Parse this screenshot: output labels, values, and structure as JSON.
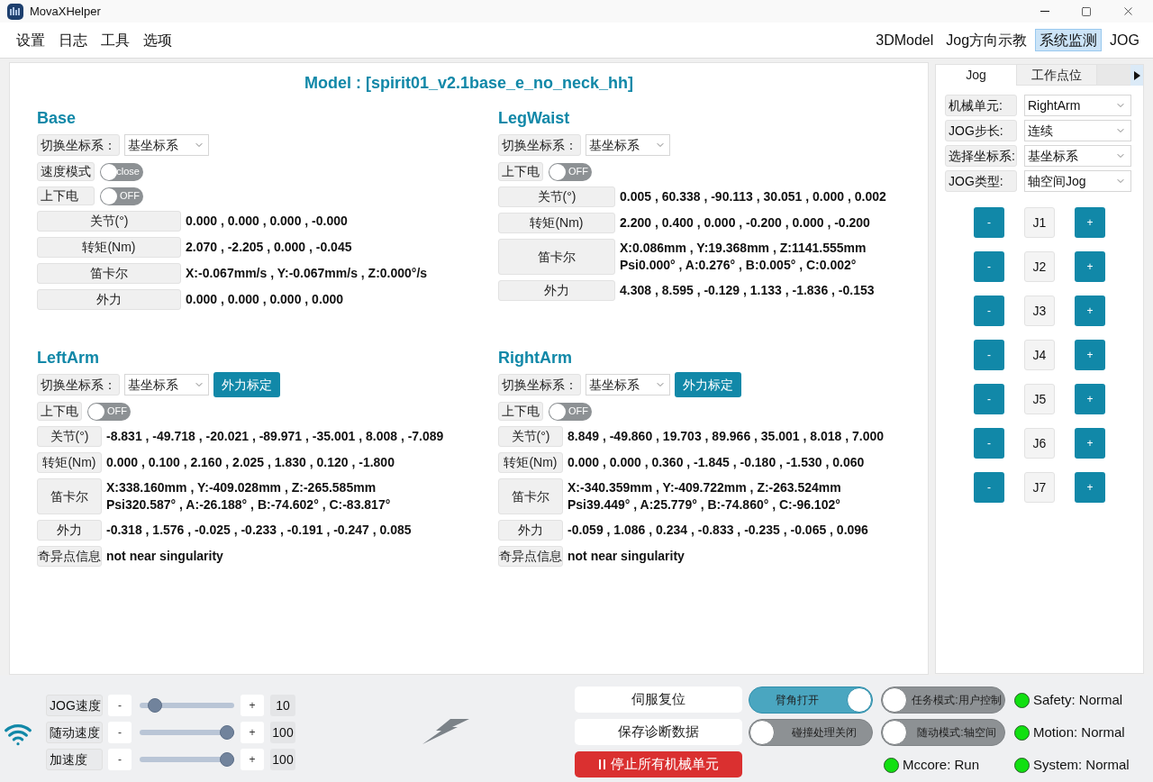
{
  "window": {
    "title": "MovaXHelper"
  },
  "menu": [
    "设置",
    "日志",
    "工具",
    "选项"
  ],
  "view_tabs": [
    {
      "label": "3DModel",
      "selected": false
    },
    {
      "label": "Jog方向示教",
      "selected": false
    },
    {
      "label": "系统监测",
      "selected": true
    },
    {
      "label": "JOG",
      "selected": false
    }
  ],
  "model_title": "Model : [spirit01_v2.1base_e_no_neck_hh]",
  "units": [
    {
      "name": "Base",
      "frame": {
        "label": "切换坐标系：",
        "value": "基坐标系"
      },
      "switches": [
        {
          "label": "速度模式",
          "text": "close",
          "on": false
        },
        {
          "label": "上下电",
          "text": "OFF",
          "on": false
        }
      ],
      "readings": [
        {
          "label": "关节(°)",
          "lines": [
            "0.000 , 0.000 , 0.000 , -0.000"
          ]
        },
        {
          "label": "转矩(Nm)",
          "lines": [
            "2.070 , -2.205 , 0.000 , -0.045"
          ]
        },
        {
          "label": "笛卡尔",
          "lines": [
            "X:-0.067mm/s , Y:-0.067mm/s , Z:0.000°/s"
          ]
        },
        {
          "label": "外力",
          "lines": [
            "0.000 , 0.000 , 0.000 , 0.000"
          ]
        }
      ]
    },
    {
      "name": "LegWaist",
      "frame": {
        "label": "切换坐标系：",
        "value": "基坐标系"
      },
      "switches": [
        {
          "label": "上下电",
          "text": "OFF",
          "on": false
        }
      ],
      "readings": [
        {
          "label": "关节(°)",
          "lines": [
            "0.005 , 60.338 , -90.113 , 30.051 , 0.000 , 0.002"
          ]
        },
        {
          "label": "转矩(Nm)",
          "lines": [
            "2.200 , 0.400 , 0.000 , -0.200 , 0.000 , -0.200"
          ]
        },
        {
          "label": "笛卡尔",
          "lines": [
            "X:0.086mm , Y:19.368mm , Z:1141.555mm",
            "Psi0.000° , A:0.276° , B:0.005° , C:0.002°"
          ]
        },
        {
          "label": "外力",
          "lines": [
            "4.308 , 8.595 , -0.129 , 1.133 , -1.836 , -0.153"
          ]
        }
      ]
    },
    {
      "name": "LeftArm",
      "frame": {
        "label": "切换坐标系：",
        "value": "基坐标系"
      },
      "calibrate_button": "外力标定",
      "switches": [
        {
          "label": "上下电",
          "text": "OFF",
          "on": false
        }
      ],
      "readings": [
        {
          "label": "关节(°)",
          "lines": [
            "-8.831 , -49.718 , -20.021 , -89.971 , -35.001 , 8.008 , -7.089"
          ]
        },
        {
          "label": "转矩(Nm)",
          "lines": [
            "0.000 , 0.100 , 2.160 , 2.025 , 1.830 , 0.120 , -1.800"
          ]
        },
        {
          "label": "笛卡尔",
          "lines": [
            "X:338.160mm , Y:-409.028mm , Z:-265.585mm",
            "Psi320.587° , A:-26.188° , B:-74.602° , C:-83.817°"
          ]
        },
        {
          "label": "外力",
          "lines": [
            "-0.318 , 1.576 , -0.025 , -0.233 , -0.191 , -0.247 , 0.085"
          ]
        },
        {
          "label": "奇异点信息",
          "lines": [
            "not near singularity"
          ]
        }
      ]
    },
    {
      "name": "RightArm",
      "frame": {
        "label": "切换坐标系：",
        "value": "基坐标系"
      },
      "calibrate_button": "外力标定",
      "switches": [
        {
          "label": "上下电",
          "text": "OFF",
          "on": false
        }
      ],
      "readings": [
        {
          "label": "关节(°)",
          "lines": [
            "8.849 , -49.860 , 19.703 , 89.966 , 35.001 , 8.018 , 7.000"
          ]
        },
        {
          "label": "转矩(Nm)",
          "lines": [
            "0.000 , 0.000 , 0.360 , -1.845 , -0.180 , -1.530 , 0.060"
          ]
        },
        {
          "label": "笛卡尔",
          "lines": [
            "X:-340.359mm , Y:-409.722mm , Z:-263.524mm",
            "Psi39.449° , A:25.779° , B:-74.860° , C:-96.102°"
          ]
        },
        {
          "label": "外力",
          "lines": [
            "-0.059 , 1.086 , 0.234 , -0.833 , -0.235 , -0.065 , 0.096"
          ]
        },
        {
          "label": "奇异点信息",
          "lines": [
            "not near singularity"
          ]
        }
      ]
    }
  ],
  "jog_panel": {
    "tabs": [
      {
        "label": "Jog",
        "selected": true
      },
      {
        "label": "工作点位",
        "selected": false
      }
    ],
    "fields": [
      {
        "label": "机械单元:",
        "value": "RightArm"
      },
      {
        "label": "JOG步长:",
        "value": "连续"
      },
      {
        "label": "选择坐标系:",
        "value": "基坐标系"
      },
      {
        "label": "JOG类型:",
        "value": "轴空间Jog"
      }
    ],
    "joints": [
      {
        "minus": "-",
        "name": "J1",
        "plus": "+"
      },
      {
        "minus": "-",
        "name": "J2",
        "plus": "+"
      },
      {
        "minus": "-",
        "name": "J3",
        "plus": "+"
      },
      {
        "minus": "-",
        "name": "J4",
        "plus": "+"
      },
      {
        "minus": "-",
        "name": "J5",
        "plus": "+"
      },
      {
        "minus": "-",
        "name": "J6",
        "plus": "+"
      },
      {
        "minus": "-",
        "name": "J7",
        "plus": "+"
      }
    ]
  },
  "speed_controls": [
    {
      "label": "JOG速度",
      "minus": "-",
      "plus": "+",
      "level": 0.1,
      "value": "10"
    },
    {
      "label": "随动速度",
      "minus": "-",
      "plus": "+",
      "level": 1,
      "value": "100"
    },
    {
      "label": "加速度",
      "minus": "-",
      "plus": "+",
      "level": 1,
      "value": "100"
    }
  ],
  "actions": [
    {
      "label": "伺服复位",
      "kind": "plain"
    },
    {
      "label": "保存诊断数据",
      "kind": "plain"
    },
    {
      "label": "停止所有机械单元",
      "kind": "danger"
    }
  ],
  "mode_switches": [
    {
      "label": "臂角打开",
      "on": true
    },
    {
      "label": "任务模式:用户控制",
      "on": false
    },
    {
      "label": "碰撞处理关闭",
      "on": false
    },
    {
      "label": "随动模式:轴空间",
      "on": false
    }
  ],
  "status": [
    {
      "label": "Safety: Normal",
      "color": "#11e011"
    },
    {
      "label": "Motion: Normal",
      "color": "#11e011"
    },
    {
      "label": "Mccore: Run",
      "color": "#11e011"
    },
    {
      "label": "System: Normal",
      "color": "#11e011"
    }
  ]
}
